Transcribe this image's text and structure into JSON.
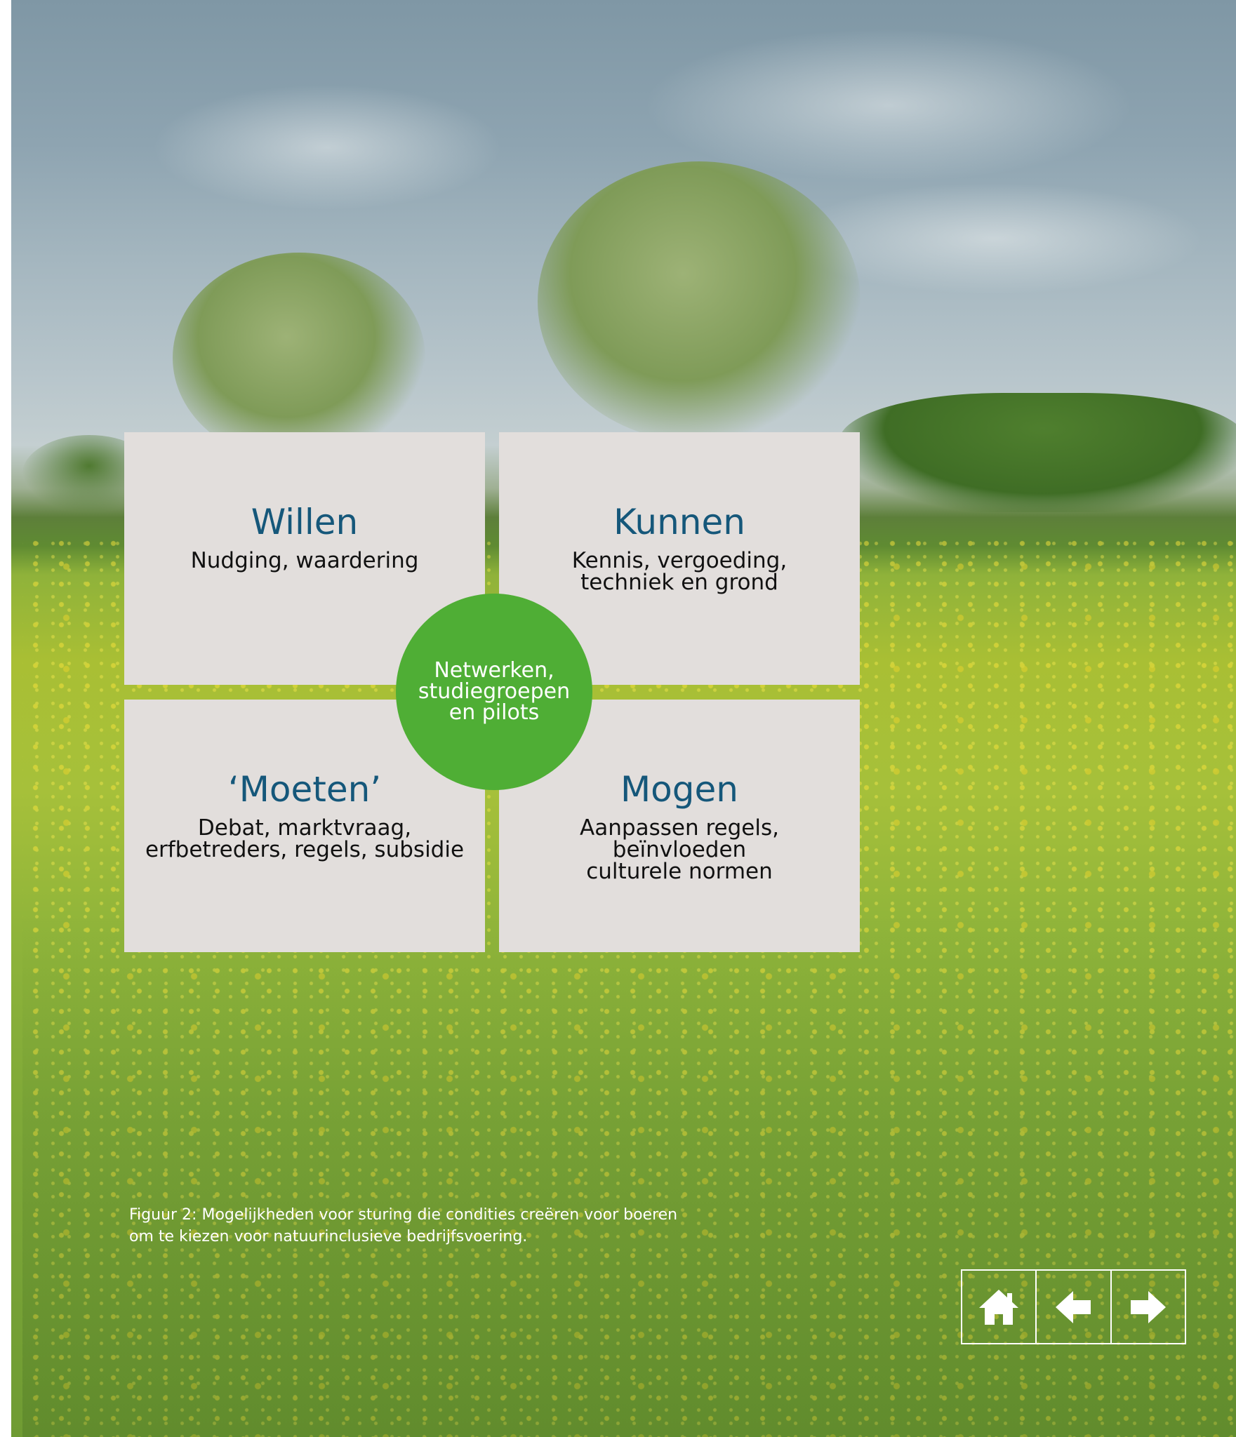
{
  "quadrants": {
    "willen": {
      "title": "Willen",
      "desc": "Nudging, waardering"
    },
    "kunnen": {
      "title": "Kunnen",
      "desc": "Kennis, vergoeding,\ntechniek en grond"
    },
    "moeten": {
      "title": "‘Moeten’",
      "desc": "Debat, marktvraag,\nerfbetreders, regels, subsidie"
    },
    "mogen": {
      "title": "Mogen",
      "desc": "Aanpassen regels,\nbeïnvloeden\nculturele normen"
    }
  },
  "center": {
    "label": "Netwerken,\nstudiegroepen\nen pilots"
  },
  "caption": "Figuur 2: Mogelijkheden voor sturing die condities creëren voor boeren\nom te kiezen voor natuurinclusieve bedrijfsvoering.",
  "nav": {
    "home_icon": "home-icon",
    "back_icon": "arrow-left-icon",
    "forward_icon": "arrow-right-icon"
  },
  "colors": {
    "card_bg": "#e2dedc",
    "title": "#15577a",
    "center_circle": "#4fae35",
    "caption_text": "#ffffff"
  }
}
